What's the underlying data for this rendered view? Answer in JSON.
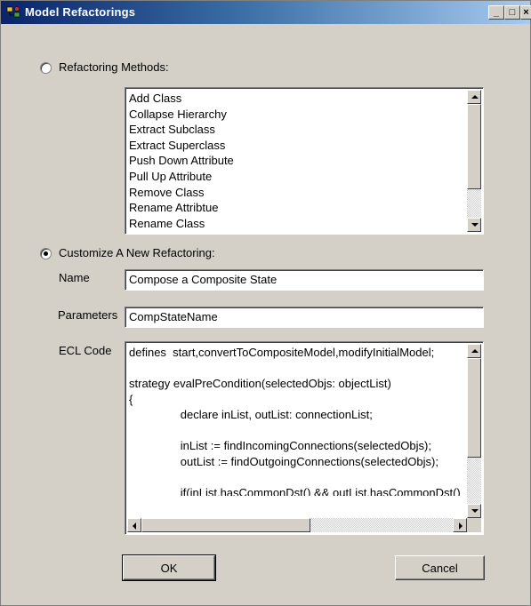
{
  "window": {
    "title": "Model Refactorings",
    "icon": "app-icon",
    "controls": {
      "minimize": "_",
      "maximize": "□",
      "close": "×"
    }
  },
  "refactoring_methods": {
    "label": "Refactoring Methods:",
    "selected": false,
    "items": [
      "Add Class",
      "Collapse Hierarchy",
      "Extract Subclass",
      "Extract Superclass",
      "Push Down Attribute",
      "Pull Up Attribute",
      "Remove Class",
      "Rename Attribtue",
      "Rename Class"
    ]
  },
  "customize": {
    "label": "Customize A New Refactoring:",
    "selected": true,
    "name_label": "Name",
    "name_value": "Compose a Composite State",
    "parameters_label": "Parameters",
    "parameters_value": "CompStateName",
    "ecl_label": "ECL Code",
    "ecl_lines": [
      "defines  start,convertToCompositeModel,modifyInitialModel;",
      "",
      "strategy evalPreCondition(selectedObjs: objectList)",
      "{",
      "                declare inList, outList: connectionList;",
      "",
      "                inList := findIncomingConnections(selectedObjs);",
      "                outList := findOutgoingConnections(selectedObjs);",
      "",
      "                if(inList.hasCommonDst() && outList.hasCommonDst())"
    ]
  },
  "buttons": {
    "ok": "OK",
    "cancel": "Cancel"
  }
}
